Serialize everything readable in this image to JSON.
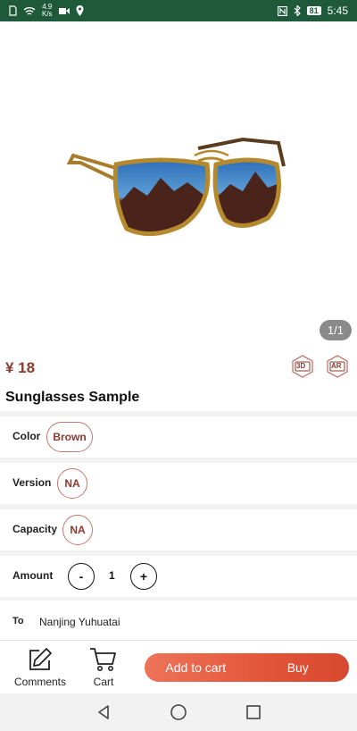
{
  "status_bar": {
    "speed_value": "4.9",
    "speed_unit": "K/s",
    "battery": "81",
    "time": "5:45"
  },
  "product": {
    "image_alt": "Sunglasses",
    "image_index": "1/1",
    "price": "¥ 18",
    "badge_3d": "3D",
    "badge_ar": "AR",
    "title": "Sunglasses Sample"
  },
  "options": {
    "color": {
      "label": "Color",
      "value": "Brown"
    },
    "version": {
      "label": "Version",
      "value": "NA"
    },
    "capacity": {
      "label": "Capacity",
      "value": "NA"
    },
    "amount": {
      "label": "Amount",
      "minus": "-",
      "value": "1",
      "plus": "+"
    }
  },
  "delivery": {
    "label": "To",
    "value": "Nanjing Yuhuatai"
  },
  "bottom_bar": {
    "comments_label": "Comments",
    "cart_label": "Cart",
    "add_to_cart_label": "Add to cart",
    "buy_label": "Buy"
  },
  "colors": {
    "accent": "#8b3a2e",
    "status_bar": "#1e5a3a",
    "button_orange": "#e65a3f"
  }
}
